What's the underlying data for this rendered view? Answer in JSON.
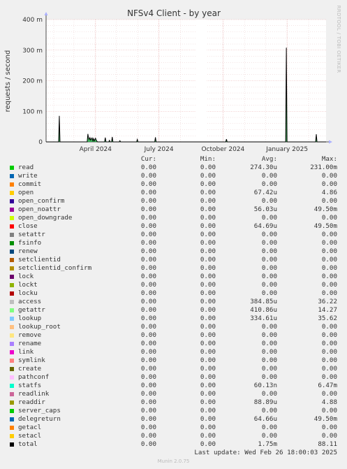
{
  "chart_data": {
    "type": "line",
    "title": "NFSv4 Client - by year",
    "ylabel": "requests / second",
    "side_text": "RRDTOOL / TOBI OETIKER",
    "ylim": [
      0,
      400
    ],
    "y_ticks": [
      {
        "value": 0,
        "label": "0"
      },
      {
        "value": 100,
        "label": "100 m"
      },
      {
        "value": 200,
        "label": "200 m"
      },
      {
        "value": 300,
        "label": "300 m"
      },
      {
        "value": 400,
        "label": "400 m"
      }
    ],
    "y_unit_note": "values in milli-requests/second",
    "xlim": [
      "2024-01-21",
      "2025-02-26"
    ],
    "x_ticks": [
      {
        "date": "2024-04-01",
        "label": "April 2024"
      },
      {
        "date": "2024-07-01",
        "label": "July 2024"
      },
      {
        "date": "2024-10-01",
        "label": "October 2024"
      },
      {
        "date": "2025-01-01",
        "label": "January 2025"
      }
    ],
    "x_gridlines_months": [
      "2024-02-01",
      "2024-03-01",
      "2024-04-01",
      "2024-05-01",
      "2024-06-01",
      "2024-07-01",
      "2024-08-01",
      "2024-09-01",
      "2024-10-01",
      "2024-11-01",
      "2024-12-01",
      "2025-01-01",
      "2025-02-01"
    ],
    "gaps": [
      [
        "2024-08-23",
        "2024-09-08"
      ]
    ],
    "grid": true,
    "series": [
      {
        "name": "total",
        "color": "#000000",
        "points": [
          [
            "2024-01-21",
            0
          ],
          [
            "2024-02-08",
            0
          ],
          [
            "2024-02-09",
            85
          ],
          [
            "2024-02-10",
            0
          ],
          [
            "2024-03-20",
            0
          ],
          [
            "2024-03-21",
            26
          ],
          [
            "2024-03-22",
            12
          ],
          [
            "2024-03-23",
            8
          ],
          [
            "2024-03-24",
            14
          ],
          [
            "2024-03-25",
            6
          ],
          [
            "2024-03-26",
            10
          ],
          [
            "2024-03-27",
            13
          ],
          [
            "2024-03-28",
            4
          ],
          [
            "2024-03-29",
            11
          ],
          [
            "2024-03-30",
            3
          ],
          [
            "2024-03-31",
            8
          ],
          [
            "2024-04-01",
            12
          ],
          [
            "2024-04-02",
            6
          ],
          [
            "2024-04-03",
            2
          ],
          [
            "2024-04-04",
            0
          ],
          [
            "2024-04-14",
            0
          ],
          [
            "2024-04-15",
            14
          ],
          [
            "2024-04-16",
            0
          ],
          [
            "2024-04-20",
            0
          ],
          [
            "2024-04-21",
            5
          ],
          [
            "2024-04-22",
            0
          ],
          [
            "2024-04-24",
            0
          ],
          [
            "2024-04-25",
            16
          ],
          [
            "2024-04-26",
            0
          ],
          [
            "2024-05-05",
            0
          ],
          [
            "2024-05-06",
            4
          ],
          [
            "2024-05-07",
            0
          ],
          [
            "2024-05-30",
            0
          ],
          [
            "2024-05-31",
            8
          ],
          [
            "2024-06-01",
            0
          ],
          [
            "2024-06-25",
            0
          ],
          [
            "2024-06-26",
            15
          ],
          [
            "2024-06-27",
            0
          ],
          [
            "2024-08-22",
            0
          ],
          [
            "2024-09-09",
            0
          ],
          [
            "2024-10-05",
            0
          ],
          [
            "2024-10-06",
            9
          ],
          [
            "2024-10-07",
            0
          ],
          [
            "2024-12-30",
            0
          ],
          [
            "2024-12-31",
            308
          ],
          [
            "2025-01-01",
            0
          ],
          [
            "2025-02-11",
            0
          ],
          [
            "2025-02-12",
            25
          ],
          [
            "2025-02-13",
            0
          ],
          [
            "2025-02-26",
            0
          ]
        ]
      }
    ]
  },
  "legend": {
    "headers": {
      "cur": "Cur:",
      "min": "Min:",
      "avg": "Avg:",
      "max": "Max:"
    },
    "rows": [
      {
        "name": "read",
        "color": "#00cc00",
        "cur": "0.00",
        "min": "0.00",
        "avg": "274.30u",
        "max": "231.00m"
      },
      {
        "name": "write",
        "color": "#0066b3",
        "cur": "0.00",
        "min": "0.00",
        "avg": "0.00",
        "max": "0.00"
      },
      {
        "name": "commit",
        "color": "#ff8000",
        "cur": "0.00",
        "min": "0.00",
        "avg": "0.00",
        "max": "0.00"
      },
      {
        "name": "open",
        "color": "#ffcc00",
        "cur": "0.00",
        "min": "0.00",
        "avg": "67.42u",
        "max": "4.86"
      },
      {
        "name": "open_confirm",
        "color": "#330099",
        "cur": "0.00",
        "min": "0.00",
        "avg": "0.00",
        "max": "0.00"
      },
      {
        "name": "open_noattr",
        "color": "#990099",
        "cur": "0.00",
        "min": "0.00",
        "avg": "56.03u",
        "max": "49.50m"
      },
      {
        "name": "open_downgrade",
        "color": "#ccff00",
        "cur": "0.00",
        "min": "0.00",
        "avg": "0.00",
        "max": "0.00"
      },
      {
        "name": "close",
        "color": "#ff0000",
        "cur": "0.00",
        "min": "0.00",
        "avg": "64.69u",
        "max": "49.50m"
      },
      {
        "name": "setattr",
        "color": "#808080",
        "cur": "0.00",
        "min": "0.00",
        "avg": "0.00",
        "max": "0.00"
      },
      {
        "name": "fsinfo",
        "color": "#008f00",
        "cur": "0.00",
        "min": "0.00",
        "avg": "0.00",
        "max": "0.00"
      },
      {
        "name": "renew",
        "color": "#00487d",
        "cur": "0.00",
        "min": "0.00",
        "avg": "0.00",
        "max": "0.00"
      },
      {
        "name": "setclientid",
        "color": "#b35a00",
        "cur": "0.00",
        "min": "0.00",
        "avg": "0.00",
        "max": "0.00"
      },
      {
        "name": "setclientid_confirm",
        "color": "#b38f00",
        "cur": "0.00",
        "min": "0.00",
        "avg": "0.00",
        "max": "0.00"
      },
      {
        "name": "lock",
        "color": "#6b006b",
        "cur": "0.00",
        "min": "0.00",
        "avg": "0.00",
        "max": "0.00"
      },
      {
        "name": "lockt",
        "color": "#8fb300",
        "cur": "0.00",
        "min": "0.00",
        "avg": "0.00",
        "max": "0.00"
      },
      {
        "name": "locku",
        "color": "#b30000",
        "cur": "0.00",
        "min": "0.00",
        "avg": "0.00",
        "max": "0.00"
      },
      {
        "name": "access",
        "color": "#bebebe",
        "cur": "0.00",
        "min": "0.00",
        "avg": "384.85u",
        "max": "36.22"
      },
      {
        "name": "getattr",
        "color": "#80ff80",
        "cur": "0.00",
        "min": "0.00",
        "avg": "410.86u",
        "max": "14.27"
      },
      {
        "name": "lookup",
        "color": "#80c9ff",
        "cur": "0.00",
        "min": "0.00",
        "avg": "334.61u",
        "max": "35.62"
      },
      {
        "name": "lookup_root",
        "color": "#ffc080",
        "cur": "0.00",
        "min": "0.00",
        "avg": "0.00",
        "max": "0.00"
      },
      {
        "name": "remove",
        "color": "#ffe680",
        "cur": "0.00",
        "min": "0.00",
        "avg": "0.00",
        "max": "0.00"
      },
      {
        "name": "rename",
        "color": "#aa80ff",
        "cur": "0.00",
        "min": "0.00",
        "avg": "0.00",
        "max": "0.00"
      },
      {
        "name": "link",
        "color": "#ee00cc",
        "cur": "0.00",
        "min": "0.00",
        "avg": "0.00",
        "max": "0.00"
      },
      {
        "name": "symlink",
        "color": "#ff8080",
        "cur": "0.00",
        "min": "0.00",
        "avg": "0.00",
        "max": "0.00"
      },
      {
        "name": "create",
        "color": "#666600",
        "cur": "0.00",
        "min": "0.00",
        "avg": "0.00",
        "max": "0.00"
      },
      {
        "name": "pathconf",
        "color": "#ffbfff",
        "cur": "0.00",
        "min": "0.00",
        "avg": "0.00",
        "max": "0.00"
      },
      {
        "name": "statfs",
        "color": "#00ffcc",
        "cur": "0.00",
        "min": "0.00",
        "avg": "60.13n",
        "max": "6.47m"
      },
      {
        "name": "readlink",
        "color": "#cc6699",
        "cur": "0.00",
        "min": "0.00",
        "avg": "0.00",
        "max": "0.00"
      },
      {
        "name": "readdir",
        "color": "#999900",
        "cur": "0.00",
        "min": "0.00",
        "avg": "88.89u",
        "max": "4.88"
      },
      {
        "name": "server_caps",
        "color": "#00cc00",
        "cur": "0.00",
        "min": "0.00",
        "avg": "0.00",
        "max": "0.00"
      },
      {
        "name": "delegreturn",
        "color": "#0066b3",
        "cur": "0.00",
        "min": "0.00",
        "avg": "64.66u",
        "max": "49.50m"
      },
      {
        "name": "getacl",
        "color": "#ff8000",
        "cur": "0.00",
        "min": "0.00",
        "avg": "0.00",
        "max": "0.00"
      },
      {
        "name": "setacl",
        "color": "#ffcc00",
        "cur": "0.00",
        "min": "0.00",
        "avg": "0.00",
        "max": "0.00"
      },
      {
        "name": "total",
        "color": "#000000",
        "cur": "0.00",
        "min": "0.00",
        "avg": "1.75m",
        "max": "88.11"
      }
    ]
  },
  "last_update": "Last update: Wed Feb 26 18:00:03 2025",
  "footer": "Munin 2.0.75"
}
